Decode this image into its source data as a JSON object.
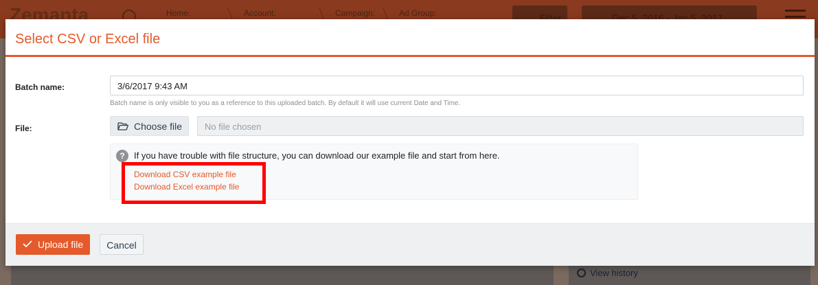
{
  "background": {
    "logo": "Zemanta",
    "breadcrumbs": [
      "Home:",
      "Account:",
      "Campaign:",
      "Ad Group:"
    ],
    "filter_label": "Filter",
    "date_range": "Dec 5, 2016 - Jan 5, 2017",
    "view_history": "View history"
  },
  "modal": {
    "title": "Select CSV or Excel file",
    "batch_label": "Batch name:",
    "batch_value": "3/6/2017 9:43 AM",
    "batch_help": "Batch name is only visible to you as a reference to this uploaded batch. By default it will use current Date and Time.",
    "file_label": "File:",
    "choose_file": "Choose file",
    "no_file": "No file chosen",
    "info_text": "If you have trouble with file structure, you can download our example file and start from here.",
    "download_csv": "Download CSV example file",
    "download_excel": "Download Excel example file",
    "upload_button": "Upload file",
    "cancel_button": "Cancel"
  },
  "colors": {
    "accent": "#e45a2a",
    "highlight": "#ff0000"
  },
  "icons": [
    "search-icon",
    "filter-icon",
    "calendar-icon",
    "chevron-down-icon",
    "menu-icon",
    "folder-open-icon",
    "question-icon",
    "check-icon",
    "history-icon"
  ]
}
